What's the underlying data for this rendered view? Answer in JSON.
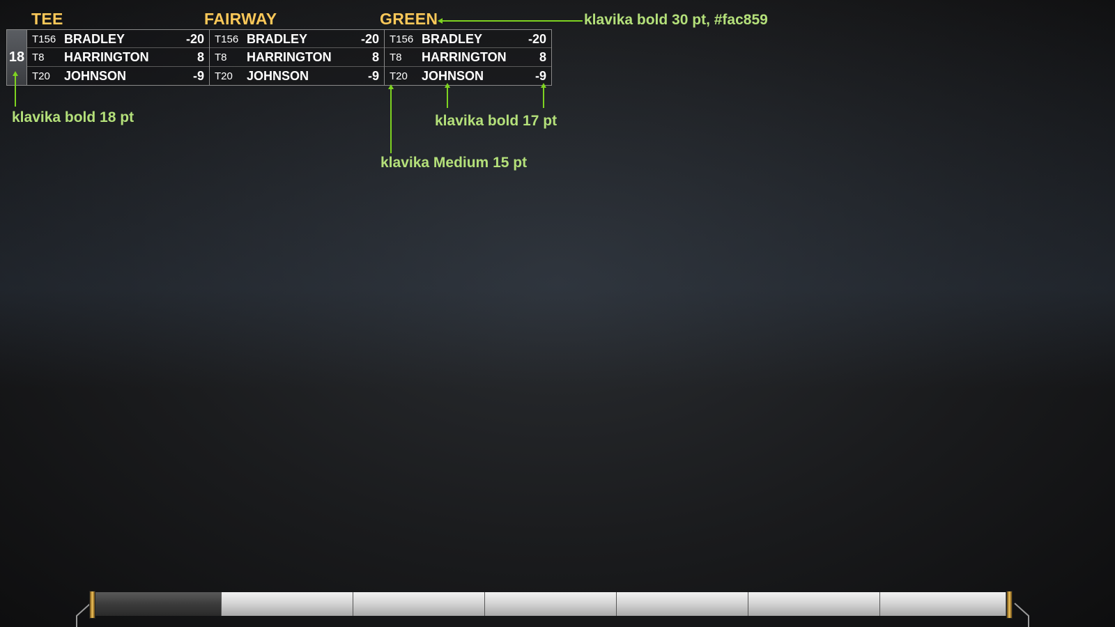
{
  "board": {
    "hole": "18",
    "panels": [
      {
        "heading": "TEE",
        "rows": [
          {
            "pos": "T156",
            "name": "BRADLEY",
            "score": "-20"
          },
          {
            "pos": "T8",
            "name": "HARRINGTON",
            "score": "8"
          },
          {
            "pos": "T20",
            "name": "JOHNSON",
            "score": "-9"
          }
        ]
      },
      {
        "heading": "FAIRWAY",
        "rows": [
          {
            "pos": "T156",
            "name": "BRADLEY",
            "score": "-20"
          },
          {
            "pos": "T8",
            "name": "HARRINGTON",
            "score": "8"
          },
          {
            "pos": "T20",
            "name": "JOHNSON",
            "score": "-9"
          }
        ]
      },
      {
        "heading": "GREEN",
        "rows": [
          {
            "pos": "T156",
            "name": "BRADLEY",
            "score": "-20"
          },
          {
            "pos": "T8",
            "name": "HARRINGTON",
            "score": "8"
          },
          {
            "pos": "T20",
            "name": "JOHNSON",
            "score": "-9"
          }
        ]
      }
    ]
  },
  "annotations": {
    "heading_font": "klavika bold 30 pt, #fac859",
    "hole_font": "klavika bold 18 pt",
    "name_score_font": "klavika bold 17 pt",
    "position_font": "klavika Medium 15 pt"
  },
  "timeline": {
    "segment_count": 7,
    "active_segment": 1
  },
  "colors": {
    "heading": "#fac859",
    "annotation_text": "#b4e07a",
    "annotation_line": "#7ed321"
  }
}
